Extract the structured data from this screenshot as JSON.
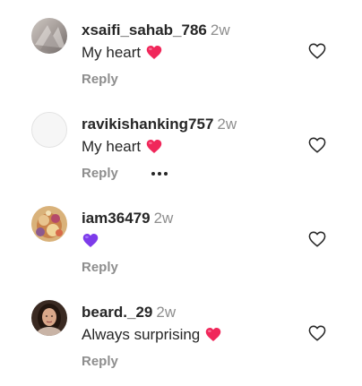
{
  "comments": [
    {
      "username": "xsaifi_sahab_786",
      "time": "2w",
      "text": "My heart",
      "emoji": "red-heart",
      "reply_label": "Reply",
      "avatar": "gray-blur-photo"
    },
    {
      "username": "ravikishanking757",
      "time": "2w",
      "text": "My heart",
      "emoji": "red-heart",
      "reply_label": "Reply",
      "more_label": "•••",
      "avatar": "blank"
    },
    {
      "username": "iam36479",
      "time": "2w",
      "text": "",
      "emoji": "purple-heart",
      "reply_label": "Reply",
      "avatar": "colorful-photo"
    },
    {
      "username": "beard._29",
      "time": "2w",
      "text": "Always surprising",
      "emoji": "red-heart",
      "reply_label": "Reply",
      "avatar": "person-photo"
    }
  ],
  "colors": {
    "username": "#262626",
    "muted": "#8e8e8e",
    "heart_emoji": "#f0275a",
    "purple_emoji": "#7d3bea",
    "like_icon_stroke": "#262626"
  }
}
